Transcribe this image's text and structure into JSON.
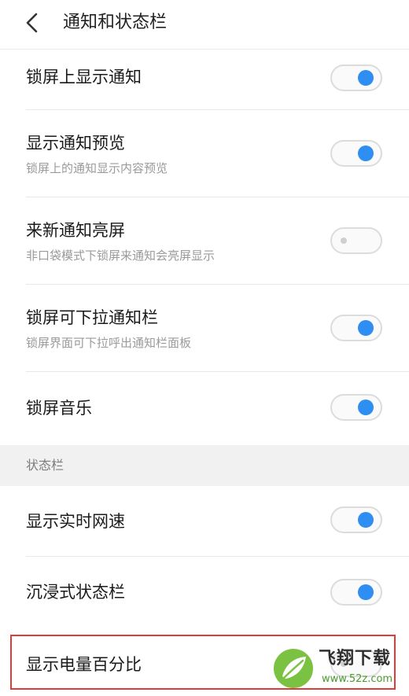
{
  "header": {
    "title": "通知和状态栏",
    "back_icon": "chevron-left-icon"
  },
  "rows": [
    {
      "title": "锁屏上显示通知",
      "subtitle": "",
      "toggle": "on"
    },
    {
      "title": "显示通知预览",
      "subtitle": "锁屏上的通知显示内容预览",
      "toggle": "on"
    },
    {
      "title": "来新通知亮屏",
      "subtitle": "非口袋模式下锁屏来通知会亮屏显示",
      "toggle": "off"
    },
    {
      "title": "锁屏可下拉通知栏",
      "subtitle": "锁屏界面可下拉呼出通知栏面板",
      "toggle": "on"
    },
    {
      "title": "锁屏音乐",
      "subtitle": "",
      "toggle": "on"
    }
  ],
  "section": {
    "label": "状态栏"
  },
  "status_rows": [
    {
      "title": "显示实时网速",
      "toggle": "on"
    },
    {
      "title": "沉浸式状态栏",
      "toggle": "on"
    },
    {
      "title": "显示电量百分比",
      "toggle": "off"
    }
  ],
  "watermark": {
    "brand": "飞翔下载",
    "url": "www.52z.com"
  },
  "colors": {
    "accent": "#2f8ef1",
    "highlight": "#e03a3a",
    "section_bg": "#f1f1f1"
  }
}
